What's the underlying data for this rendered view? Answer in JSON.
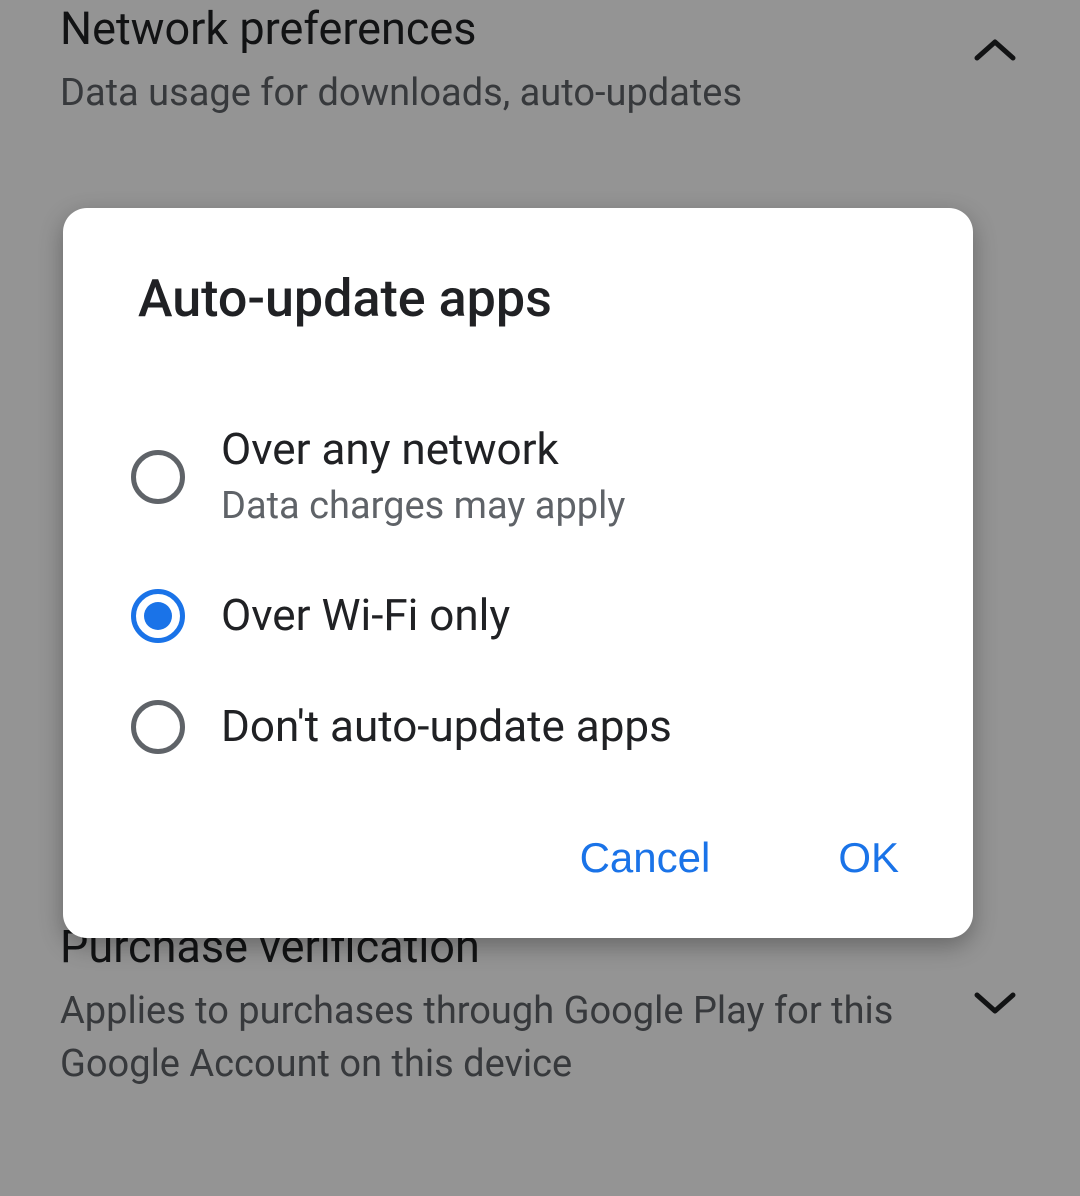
{
  "background": {
    "network_preferences": {
      "title": "Network preferences",
      "subtitle": "Data usage for downloads, auto-updates"
    },
    "purchase_verification": {
      "title": "Purchase verification",
      "subtitle": "Applies to purchases through Google Play for this Google Account on this device"
    }
  },
  "dialog": {
    "title": "Auto-update apps",
    "options": [
      {
        "label": "Over any network",
        "sublabel": "Data charges may apply",
        "selected": false
      },
      {
        "label": "Over Wi-Fi only",
        "sublabel": "",
        "selected": true
      },
      {
        "label": "Don't auto-update apps",
        "sublabel": "",
        "selected": false
      }
    ],
    "buttons": {
      "cancel": "Cancel",
      "ok": "OK"
    }
  }
}
